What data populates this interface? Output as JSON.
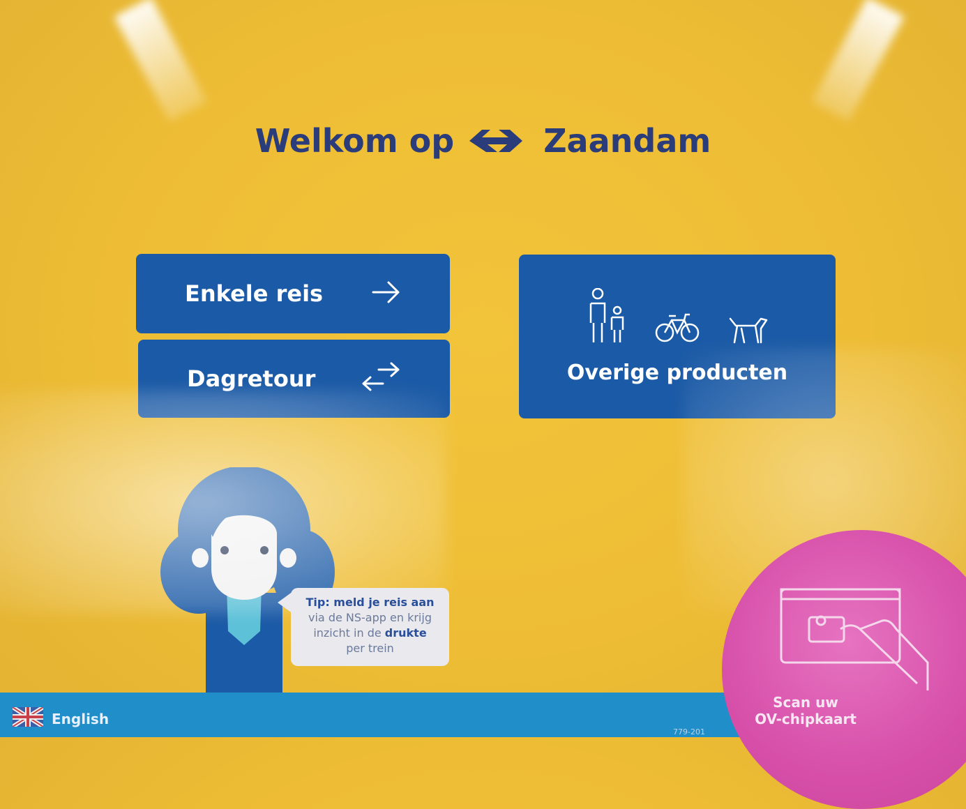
{
  "header": {
    "welcome": "Welkom op",
    "station": "Zaandam",
    "logo_icon": "ns-logo-icon"
  },
  "buttons": {
    "single": {
      "label": "Enkele reis",
      "icon": "arrow-right-icon"
    },
    "return": {
      "label": "Dagretour",
      "icon": "arrows-both-ways-icon"
    },
    "other": {
      "label": "Overige producten",
      "icons": [
        "persons-icon",
        "bicycle-icon",
        "dog-icon"
      ]
    }
  },
  "tip": {
    "line1": "Tip: meld je reis aan",
    "line2": "via de NS-app en krijg",
    "line3a": "inzicht in de ",
    "line3b": "drukte",
    "line4": "per trein"
  },
  "footer": {
    "language": "English",
    "version": "779-201"
  },
  "scan": {
    "line1": "Scan uw",
    "line2": "OV-chipkaart"
  },
  "colors": {
    "background": "#eebd35",
    "button": "#1b5aa6",
    "title": "#2a3c7a",
    "footer": "#1f8ec9",
    "scan": "#d64ea8"
  }
}
